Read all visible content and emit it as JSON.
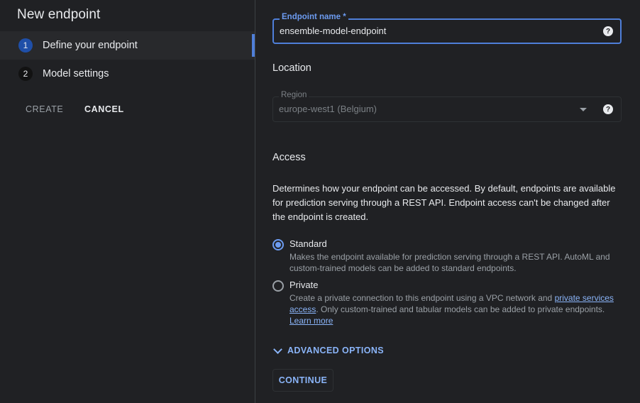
{
  "left_panel": {
    "title": "New endpoint",
    "steps": [
      {
        "number": "1",
        "label": "Define your endpoint",
        "active": true
      },
      {
        "number": "2",
        "label": "Model settings",
        "active": false
      }
    ],
    "create_label": "CREATE",
    "cancel_label": "CANCEL"
  },
  "form": {
    "endpoint_name": {
      "label": "Endpoint name *",
      "value": "ensemble-model-endpoint",
      "help_icon": "help-circle-icon"
    },
    "location_heading": "Location",
    "region": {
      "label": "Region",
      "value": "europe-west1 (Belgium)",
      "dropdown_icon": "caret-down-icon",
      "help_icon": "help-circle-icon"
    },
    "access_heading": "Access",
    "access_description": "Determines how your endpoint can be accessed. By default, endpoints are available for prediction serving through a REST API. Endpoint access can't be changed after the endpoint is created.",
    "options": {
      "standard": {
        "title": "Standard",
        "description": "Makes the endpoint available for prediction serving through a REST API. AutoML and custom-trained models can be added to standard endpoints.",
        "selected": true
      },
      "private": {
        "title": "Private",
        "description_pre": "Create a private connection to this endpoint using a VPC network and ",
        "link_text": "private services access",
        "description_post": ". Only custom-trained and tabular models can be added to private endpoints.",
        "learn_more": "Learn more",
        "selected": false
      }
    },
    "advanced_options_label": "ADVANCED OPTIONS",
    "continue_label": "CONTINUE"
  },
  "colors": {
    "background": "#202124",
    "accent": "#8ab4f8",
    "active_step": "#1f4fa8",
    "focus_border": "#4f7fd9"
  }
}
